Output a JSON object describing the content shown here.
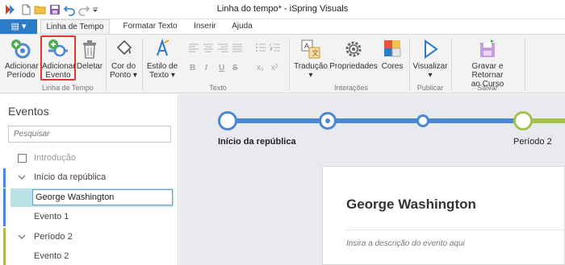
{
  "window": {
    "title": "Linha do tempo* - iSpring Visuals"
  },
  "ribbon_tabs": {
    "app_menu": "▤ ▾",
    "tabs": [
      "Linha de Tempo",
      "Formatar Texto",
      "Inserir",
      "Ajuda"
    ],
    "active": "Linha de Tempo"
  },
  "ribbon": {
    "add_period": "Adicionar\nPeríodo",
    "add_event_line1": "Adicionar",
    "add_event_line2": "Evento",
    "add_period_line1": "Adicionar",
    "add_period_line2": "Período",
    "delete": "Deletar",
    "point_color_line1": "Cor do",
    "point_color_line2": "Ponto",
    "text_style_line1": "Estilo de",
    "text_style_line2": "Texto",
    "translation": "Tradução",
    "properties": "Propriedades",
    "colors": "Cores",
    "view": "Visualizar",
    "save_return_line1": "Gravar e Retornar",
    "save_return_line2": "ao Curso",
    "groups": {
      "timeline": "Linha de Tempo",
      "text": "Texto",
      "interactions": "Interações",
      "publish": "Publicar",
      "save": "Salvar"
    },
    "format_glyphs": {
      "bold": "B",
      "italic": "I",
      "underline": "U",
      "strike": "S",
      "sub": "x₂",
      "sup": "x²"
    }
  },
  "sidebar": {
    "heading": "Eventos",
    "search_placeholder": "Pesquisar",
    "items": [
      {
        "label": "Introdução"
      },
      {
        "label": "Início da república"
      },
      {
        "label": "George Washington"
      },
      {
        "label": "Evento 1"
      },
      {
        "label": "Período 2"
      },
      {
        "label": "Evento 2"
      }
    ]
  },
  "timeline": {
    "label_start": "Início da república",
    "label_period2": "Período 2"
  },
  "event_card": {
    "title": "George Washington",
    "description_placeholder": "Insira a descrição do evento aqui"
  },
  "colors": {
    "accent_blue": "#2a7cc7",
    "period1_blue": "#4a88d6",
    "period2_green": "#a4c14a",
    "highlight_red": "#e0362c",
    "selected_row": "#b9e1e6"
  }
}
